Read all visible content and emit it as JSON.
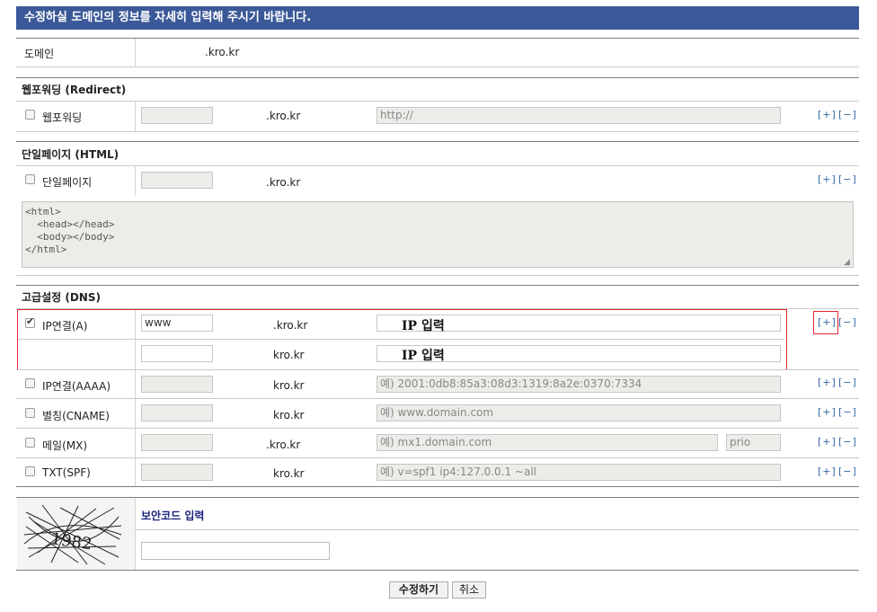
{
  "header": {
    "title": "수정하실 도메인의 정보를 자세히 입력해 주시기 바랍니다."
  },
  "domain_row": {
    "label": "도메인",
    "value": ".kro.kr"
  },
  "redirect": {
    "section_title": "웹포워딩 (Redirect)",
    "row_label": "웹포워딩",
    "domain_suffix": ".kro.kr",
    "url_placeholder": "http://",
    "plus": "[+]",
    "minus": "[−]"
  },
  "html": {
    "section_title": "단일페이지 (HTML)",
    "row_label": "단일페이지",
    "domain_suffix": ".kro.kr",
    "code": "<html>\n  <head></head>\n  <body></body>\n</html>",
    "plus": "[+]",
    "minus": "[−]"
  },
  "dns": {
    "section_title": "고급설정 (DNS)",
    "rows": [
      {
        "label": "IP연결(A)",
        "checked": true,
        "sub": "www",
        "suffix": ".kro.kr",
        "value": "IP 입력",
        "plus": "[+]",
        "minus": "[−]"
      },
      {
        "label": "",
        "sub": "",
        "suffix": "kro.kr",
        "value": "IP 입력"
      },
      {
        "label": "IP연결(AAAA)",
        "sub": "",
        "suffix": "kro.kr",
        "placeholder": "예) 2001:0db8:85a3:08d3:1319:8a2e:0370:7334",
        "plus": "[+]",
        "minus": "[−]"
      },
      {
        "label": "별칭(CNAME)",
        "sub": "",
        "suffix": "kro.kr",
        "placeholder": "예) www.domain.com",
        "plus": "[+]",
        "minus": "[−]"
      },
      {
        "label": "메일(MX)",
        "sub": "",
        "suffix": ".kro.kr",
        "placeholder": "예) mx1.domain.com",
        "prio_placeholder": "prio",
        "plus": "[+]",
        "minus": "[−]"
      },
      {
        "label": "TXT(SPF)",
        "sub": "",
        "suffix": "kro.kr",
        "placeholder": "예) v=spf1 ip4:127.0.0.1 ~all",
        "plus": "[+]",
        "minus": "[−]"
      }
    ]
  },
  "captcha": {
    "title": "보안코드 입력",
    "code_image_text": "1982",
    "input_value": ""
  },
  "buttons": {
    "submit": "수정하기",
    "cancel": "취소"
  },
  "colors": {
    "banner": "#3b5998",
    "highlight_border": "#e0282d",
    "link": "#3366aa"
  }
}
